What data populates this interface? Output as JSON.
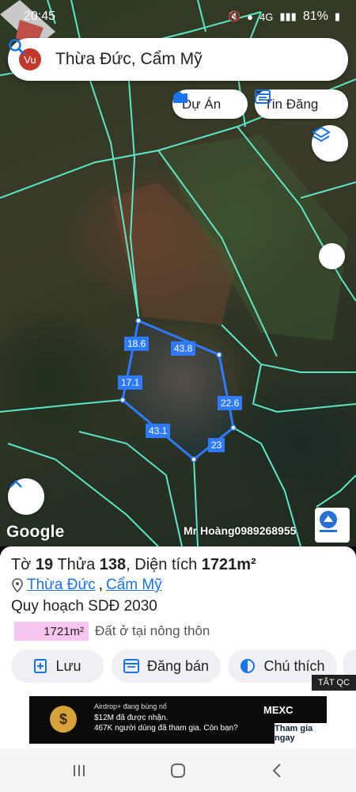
{
  "status": {
    "time": "20:45",
    "network": "4G",
    "battery": "81%"
  },
  "search": {
    "avatar_initials": "Vu",
    "query": "Thừa Đức, Cẩm Mỹ"
  },
  "chips": {
    "du_an": "Dự Án",
    "tin_dang": "Tin Đăng"
  },
  "map": {
    "edge_labels": [
      "18.6",
      "43.8",
      "17.1",
      "22.6",
      "43.1",
      "23"
    ],
    "google_label": "Google",
    "watermark": "Mr Hoàng0989268955"
  },
  "parcel": {
    "to_label": "Tờ",
    "to_value": "19",
    "thua_label": "Thửa",
    "thua_value": "138",
    "area_label": ", Diện tích",
    "area_value": "1721m²",
    "location_commune": "Thừa Đức",
    "location_sep": ", ",
    "location_district": "Cẩm Mỹ",
    "plan_label": "Quy hoạch SDĐ 2030",
    "plan_area": "1721m²",
    "land_type": "Đất ở tại nông thôn",
    "land_color": "#f7c6f0"
  },
  "actions": {
    "save": "Lưu",
    "post_sale": "Đăng bán",
    "legend": "Chú thích"
  },
  "ad": {
    "tag": "TẮT QC",
    "line1": "Airdrop+ đang bùng nổ",
    "line2": "$12M đã được nhận.",
    "line3": "467K người dùng đã tham gia. Còn bạn?",
    "brand": "MEXC",
    "cta": "Tham gia ngay"
  }
}
